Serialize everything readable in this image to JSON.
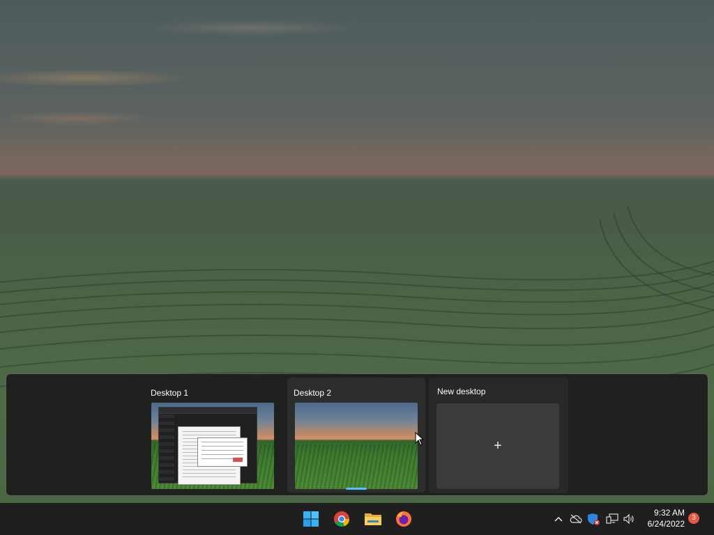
{
  "task_view": {
    "desktops": [
      {
        "name": "Desktop 1",
        "active": false
      },
      {
        "name": "Desktop 2",
        "active": true
      }
    ],
    "new_desktop_label": "New desktop",
    "add_symbol": "+"
  },
  "taskbar": {
    "apps": [
      {
        "name": "start-icon"
      },
      {
        "name": "chrome-icon"
      },
      {
        "name": "file-explorer-icon"
      },
      {
        "name": "firefox-icon"
      }
    ],
    "tray": {
      "icons": [
        "chevron-up-icon",
        "onedrive-offline-icon",
        "windows-security-icon",
        "network-icon",
        "volume-icon"
      ],
      "time": "9:32 AM",
      "date": "6/24/2022",
      "notification_count": "3"
    }
  },
  "colors": {
    "accent": "#4cc2ff",
    "taskbar": "#1f1f1f",
    "badge": "#e65745"
  }
}
